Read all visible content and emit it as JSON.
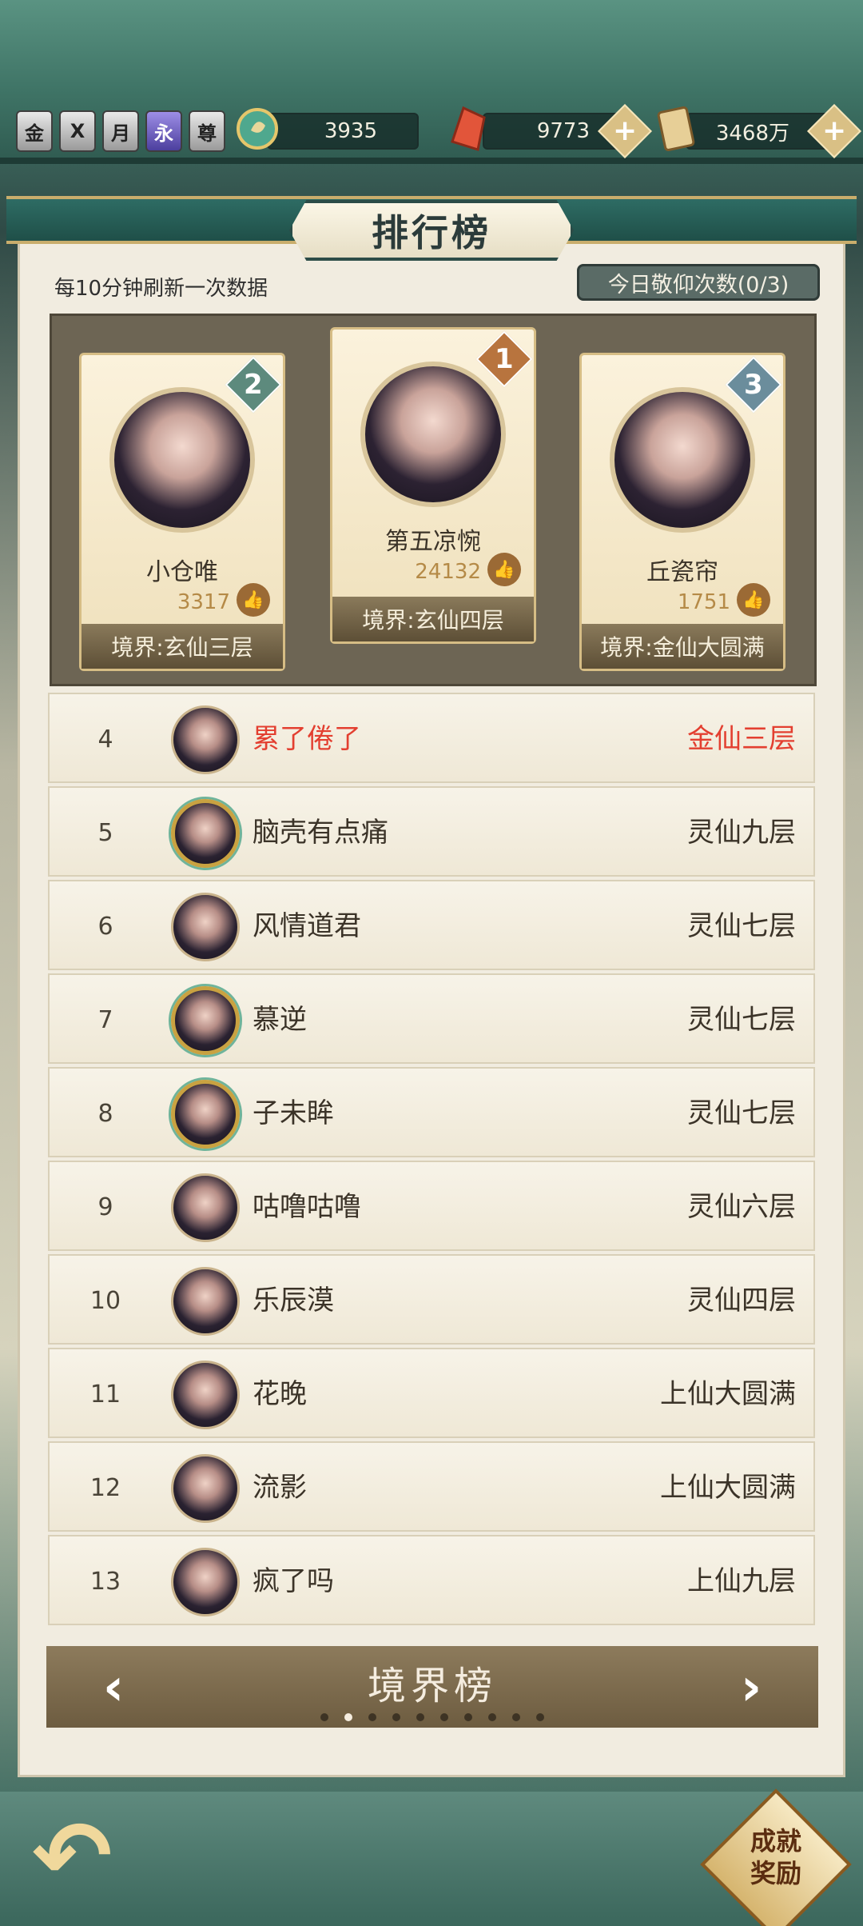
{
  "currencies": {
    "badges": [
      "金",
      "X",
      "月",
      "永",
      "尊"
    ],
    "jade": "3935",
    "crystal": "9773",
    "scroll": "3468万"
  },
  "header": {
    "title": "排行榜"
  },
  "refresh_note": "每10分钟刷新一次数据",
  "worship_button": "今日敬仰次数(0/3)",
  "podium": [
    {
      "rank": "2",
      "name": "小仓唯",
      "likes": "3317",
      "realm": "境界:玄仙三层"
    },
    {
      "rank": "1",
      "name": "第五凉惋",
      "likes": "24132",
      "realm": "境界:玄仙四层"
    },
    {
      "rank": "3",
      "name": "丘瓷帘",
      "likes": "1751",
      "realm": "境界:金仙大圆满"
    }
  ],
  "rows": [
    {
      "rank": "4",
      "name": "累了倦了",
      "realm": "金仙三层"
    },
    {
      "rank": "5",
      "name": "脑壳有点痛",
      "realm": "灵仙九层"
    },
    {
      "rank": "6",
      "name": "风情道君",
      "realm": "灵仙七层"
    },
    {
      "rank": "7",
      "name": "慕逆",
      "realm": "灵仙七层"
    },
    {
      "rank": "8",
      "name": "子未眸",
      "realm": "灵仙七层"
    },
    {
      "rank": "9",
      "name": "咕噜咕噜",
      "realm": "灵仙六层"
    },
    {
      "rank": "10",
      "name": "乐辰漠",
      "realm": "灵仙四层"
    },
    {
      "rank": "11",
      "name": "花晚",
      "realm": "上仙大圆满"
    },
    {
      "rank": "12",
      "name": "流影",
      "realm": "上仙大圆满"
    },
    {
      "rank": "13",
      "name": "疯了吗",
      "realm": "上仙九层"
    }
  ],
  "footer": {
    "title": "境界榜",
    "page_index": 2,
    "page_count": 10
  },
  "bottom": {
    "achievement_line1": "成就",
    "achievement_line2": "奖励"
  }
}
